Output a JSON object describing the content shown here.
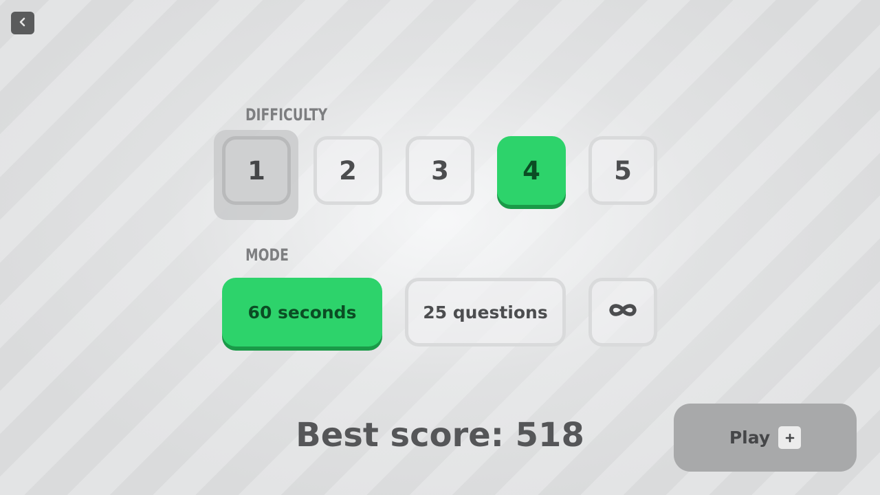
{
  "header": {
    "back_icon": "chevron-left-icon"
  },
  "difficulty": {
    "label": "DIFFICULTY",
    "levels": [
      "1",
      "2",
      "3",
      "4",
      "5"
    ],
    "selected": "4",
    "focused": "1"
  },
  "mode": {
    "label": "MODE",
    "options": [
      "60 seconds",
      "25 questions"
    ],
    "infinite_icon": "infinity-icon",
    "selected": "60 seconds"
  },
  "best_score": {
    "text": "Best score: 518"
  },
  "play": {
    "label": "Play",
    "icon": "plus-icon"
  },
  "colors": {
    "accent_green": "#2dd36b",
    "accent_green_shadow": "#1a9a48",
    "selected_text": "#0b4d24",
    "text_dark": "#4c4d4f",
    "label_gray": "#7d7e80",
    "play_bg": "#a8a9aa"
  }
}
